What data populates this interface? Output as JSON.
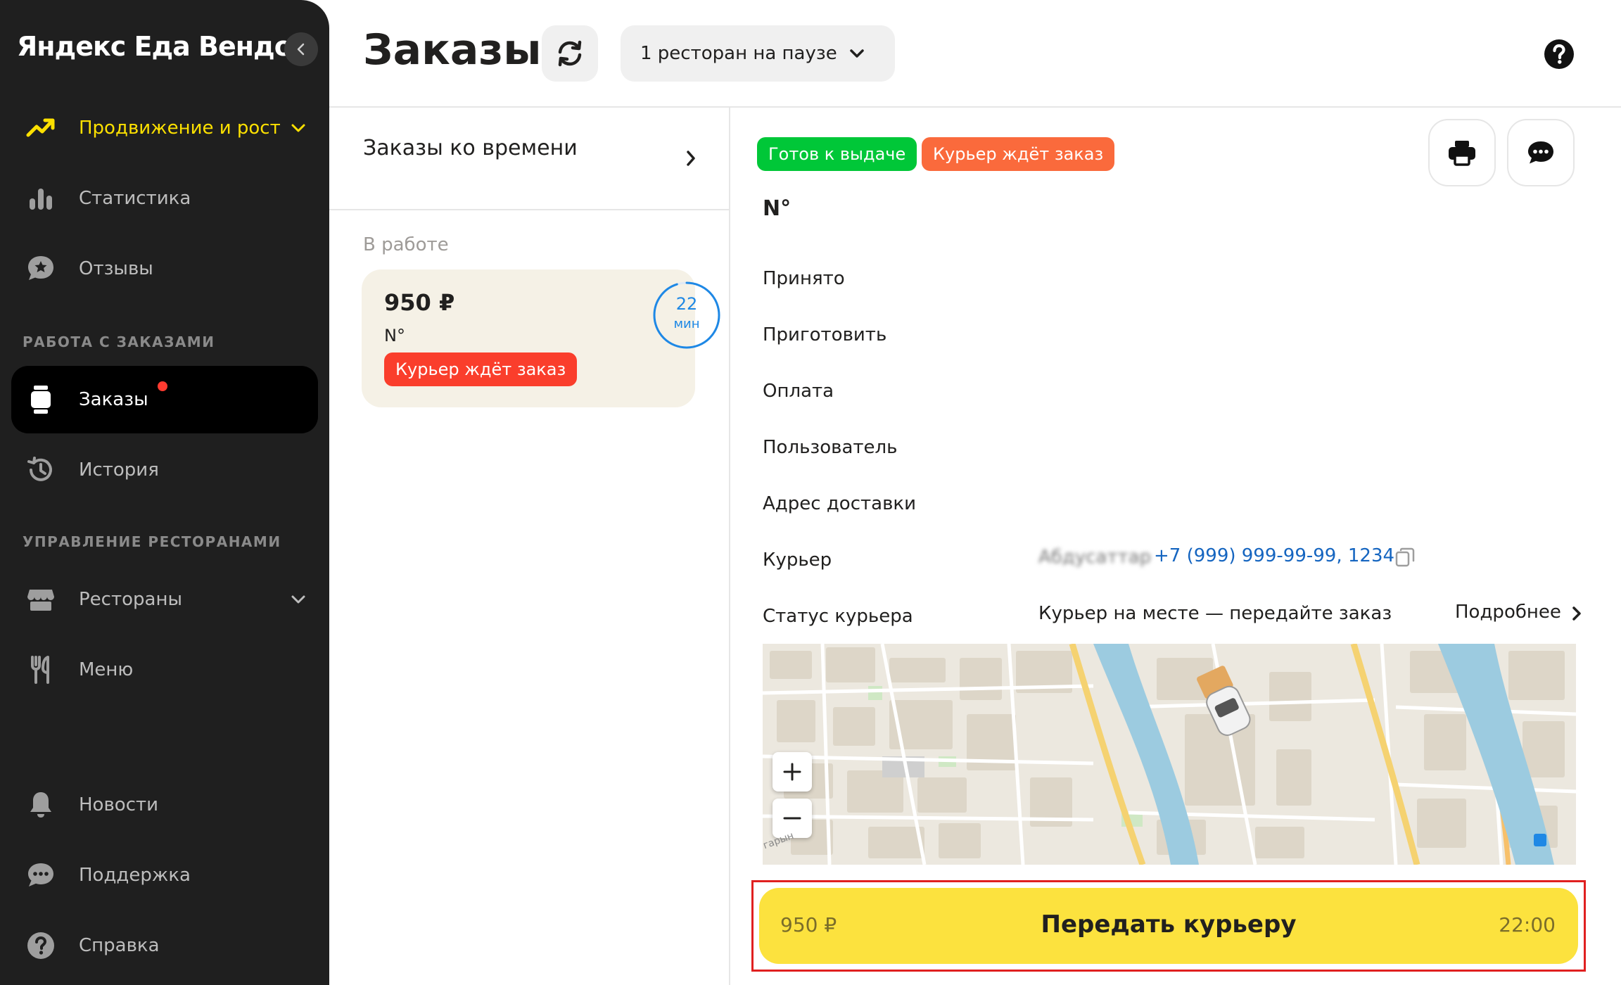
{
  "sidebar": {
    "brand": "Яндекс Еда Вендор",
    "items": {
      "promo": "Продвижение и рост",
      "stats": "Статистика",
      "reviews": "Отзывы",
      "orders": "Заказы",
      "history": "История",
      "restaurants": "Рестораны",
      "menu": "Меню",
      "news": "Новости",
      "support": "Поддержка",
      "help": "Справка"
    },
    "sections": {
      "orders_work": "РАБОТА С ЗАКАЗАМИ",
      "restaurants_mgmt": "УПРАВЛЕНИЕ РЕСТОРАНАМИ"
    }
  },
  "header": {
    "title": "Заказы",
    "pause_select": "1 ресторан на паузе"
  },
  "list": {
    "time_orders": "Заказы ко времени",
    "in_work": "В работе",
    "card": {
      "price": "950 ₽",
      "number": "N°",
      "badge": "Курьер ждёт заказ",
      "timer_value": "22",
      "timer_unit": "мин",
      "timer_progress": 0.95
    }
  },
  "detail": {
    "badge_ready": "Готов к выдаче",
    "badge_courier": "Курьер ждёт заказ",
    "order_number": "N°",
    "rows": {
      "accepted": "Принято",
      "prepare": "Приготовить",
      "payment": "Оплата",
      "user": "Пользователь",
      "address": "Адрес доставки",
      "courier": "Курьер",
      "courier_status": "Статус курьера"
    },
    "courier_name": "Абдусаттар",
    "courier_phone": "+7 (999) 999-99-99, 1234",
    "courier_status_value": "Курьер на месте — передайте заказ",
    "more": "Подробнее",
    "map_label": "гарын"
  },
  "handover": {
    "price": "950 ₽",
    "label": "Передать курьеру",
    "time": "22:00"
  },
  "colors": {
    "accent_yellow": "#fce000",
    "button_yellow": "#fce23e",
    "green": "#00c738",
    "orange": "#fa6a3c",
    "red": "#fa3e2c",
    "link_blue": "#1565c0"
  }
}
